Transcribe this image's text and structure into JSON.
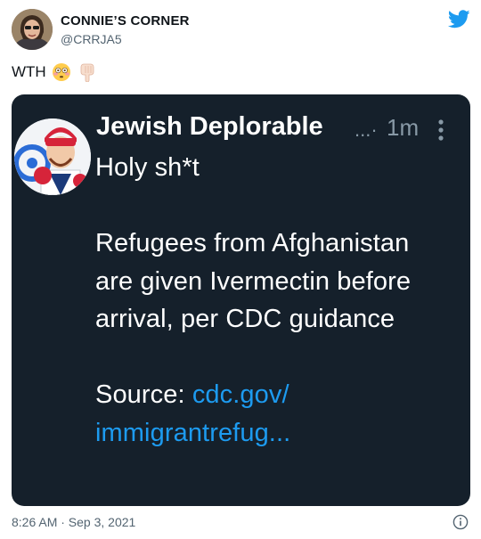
{
  "tweet": {
    "author_name": "CONNIE’S CORNER",
    "author_handle": "@CRRJA5",
    "text": "WTH",
    "emojis": [
      "flushed-face-emoji",
      "backhand-index-pointing-down-emoji"
    ],
    "timestamp": "8:26 AM · Sep 3, 2021"
  },
  "embedded": {
    "author_name": "Jewish Deplorable",
    "ellipsis": "...·",
    "time": "1m",
    "lines": [
      "Holy sh*t",
      "Refugees from Afghanistan",
      "are given Ivermectin before",
      "arrival, per CDC guidance"
    ],
    "source_label": "Source: ",
    "link_part1": "cdc.gov/",
    "link_part2": "immigrantrefug..."
  },
  "colors": {
    "twitter_blue": "#1d9bf0",
    "dark_bg": "#15202b",
    "muted": "#536471"
  }
}
